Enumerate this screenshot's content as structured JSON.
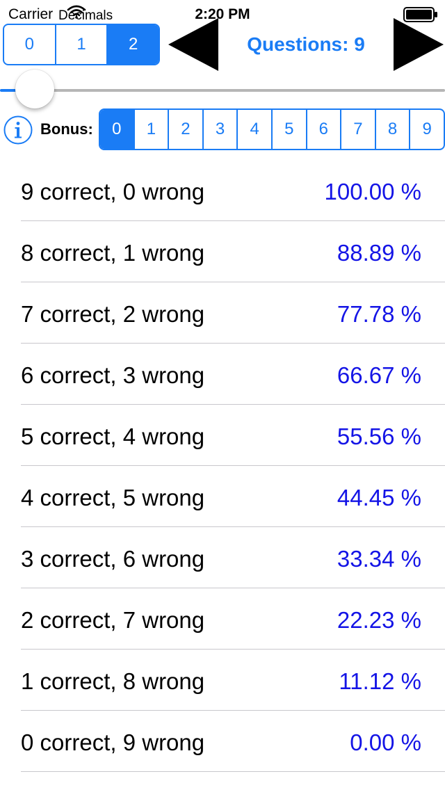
{
  "status_bar": {
    "carrier": "Carrier",
    "app_overlay_label": "Decimals",
    "time": "2:20 PM",
    "wifi_icon": "wifi-icon",
    "battery_icon": "battery-icon"
  },
  "decimals": {
    "options": [
      "0",
      "1",
      "2"
    ],
    "selected_index": 2
  },
  "nav": {
    "title": "Questions: 9",
    "prev_icon": "triangle-left-icon",
    "next_icon": "triangle-right-icon"
  },
  "slider": {
    "value_fraction": 0.0
  },
  "bonus": {
    "info_icon": "info-icon",
    "label": "Bonus:",
    "options": [
      "0",
      "1",
      "2",
      "3",
      "4",
      "5",
      "6",
      "7",
      "8",
      "9"
    ],
    "selected_index": 0
  },
  "results": [
    {
      "label": "9 correct, 0 wrong",
      "value": "100.00 %"
    },
    {
      "label": "8 correct, 1 wrong",
      "value": "88.89 %"
    },
    {
      "label": "7 correct, 2 wrong",
      "value": "77.78 %"
    },
    {
      "label": "6 correct, 3 wrong",
      "value": "66.67 %"
    },
    {
      "label": "5 correct, 4 wrong",
      "value": "55.56 %"
    },
    {
      "label": "4 correct, 5 wrong",
      "value": "44.45 %"
    },
    {
      "label": "3 correct, 6 wrong",
      "value": "33.34 %"
    },
    {
      "label": "2 correct, 7 wrong",
      "value": "22.23 %"
    },
    {
      "label": "1 correct, 8 wrong",
      "value": "11.12 %"
    },
    {
      "label": "0 correct, 9 wrong",
      "value": "0.00 %"
    }
  ],
  "colors": {
    "accent": "#1a7cf5",
    "percent_text": "#1414e6",
    "separator": "#c8c7cc",
    "slider_track": "#b6b6b6"
  }
}
